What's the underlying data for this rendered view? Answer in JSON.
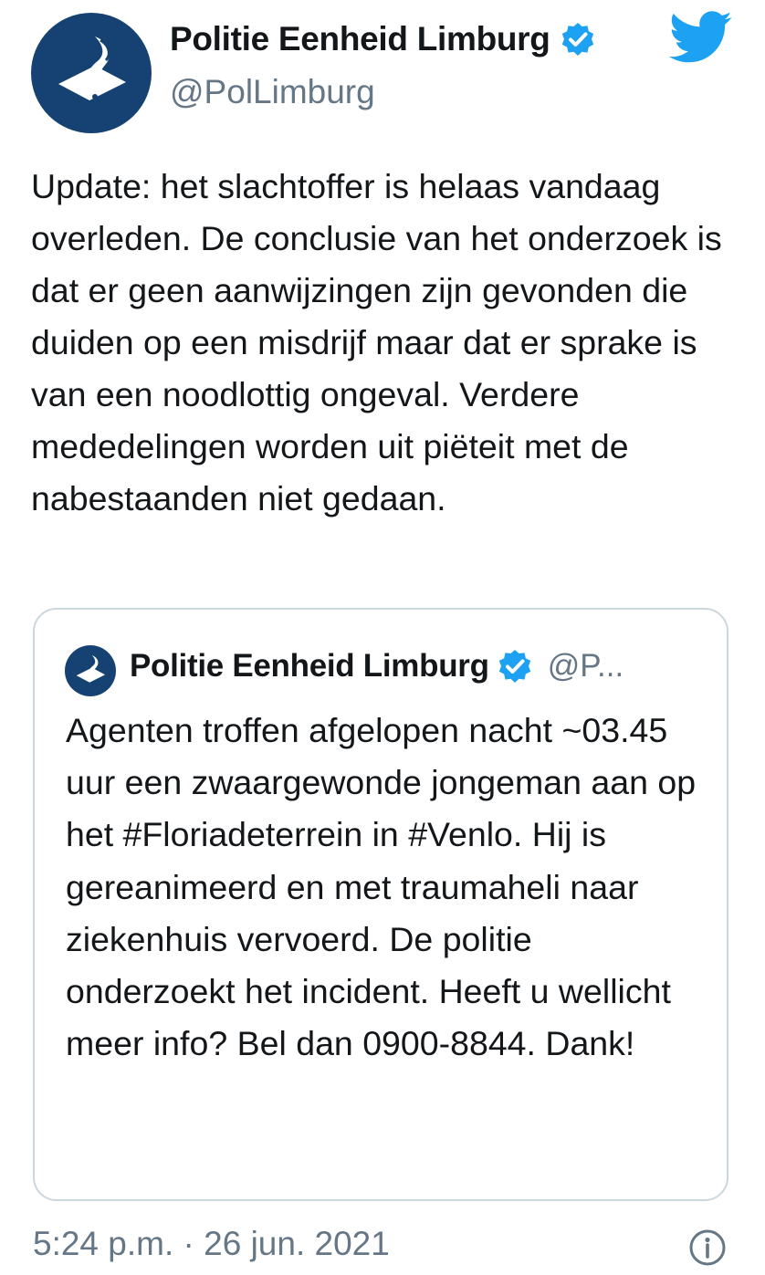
{
  "tweet": {
    "author_name": "Politie Eenheid Limburg",
    "author_handle": "@PolLimburg",
    "text": "Update: het slachtoffer is helaas vandaag overleden. De conclusie van het onderzoek is dat er geen aanwijzingen zijn gevonden die duiden op een misdrijf maar dat er sprake is van een noodlottig ongeval. Verdere mededelingen worden uit piëteit met de nabestaanden niet gedaan.",
    "timestamp": "5:24 p.m. · 26 jun. 2021"
  },
  "quoted_tweet": {
    "author_name": "Politie Eenheid Limburg",
    "author_handle": "@P...",
    "text": "Agenten troffen afgelopen nacht ~03.45 uur een zwaargewonde jongeman aan op het #Floriadeterrein in #Venlo. Hij is gereanimeerd en met traumaheli naar ziekenhuis vervoerd. De politie onderzoekt het incident. Heeft u wellicht meer info? Bel dan 0900-8844. Dank!"
  },
  "icons": {
    "avatar": "police-logo-icon",
    "verified": "verified-badge-icon",
    "brand": "twitter-bird-icon",
    "info": "info-icon"
  },
  "colors": {
    "police_blue": "#154273",
    "twitter_blue": "#1da1f2",
    "secondary_text": "#657786",
    "border": "#ccd6dd"
  }
}
